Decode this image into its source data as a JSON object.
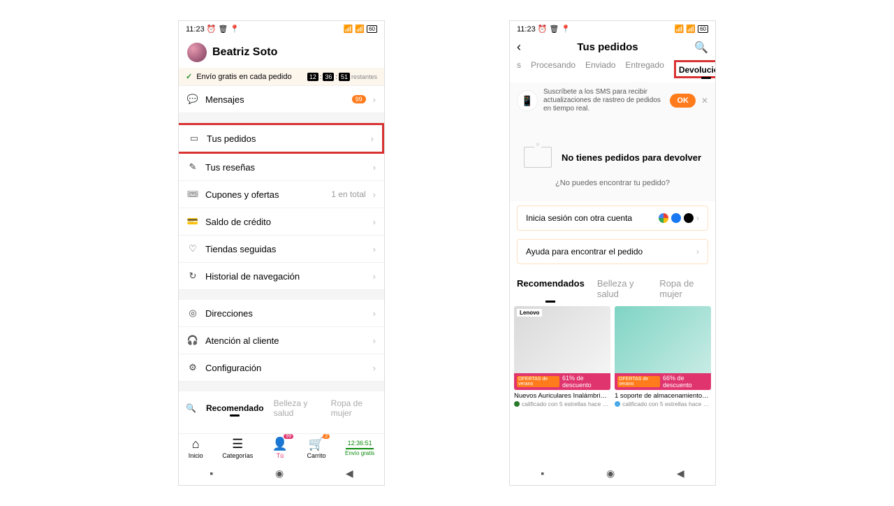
{
  "statusbar": {
    "time": "11:23"
  },
  "phone1": {
    "profile_name": "Beatriz Soto",
    "banner_text": "Envío gratis en cada pedido",
    "countdown": [
      "12",
      "36",
      "51"
    ],
    "countdown_rest": "restantes",
    "menu": {
      "mensajes": "Mensajes",
      "mensajes_badge": "99",
      "pedidos": "Tus pedidos",
      "resenas": "Tus reseñas",
      "cupones": "Cupones y ofertas",
      "cupones_trail": "1 en total",
      "saldo": "Saldo de crédito",
      "tiendas": "Tiendas seguidas",
      "historial": "Historial de navegación",
      "direcciones": "Direcciones",
      "atencion": "Atención al cliente",
      "config": "Configuración"
    },
    "rec_tabs": {
      "recom": "Recomendado",
      "belleza": "Belleza y salud",
      "ropa": "Ropa de mujer"
    },
    "bottom": {
      "inicio": "Inicio",
      "cat": "Categorías",
      "tu": "Tú",
      "tu_badge": "99",
      "carrito": "Carrito",
      "carrito_badge": "2",
      "envio_time": "12:36:51",
      "envio": "Envío gratis"
    }
  },
  "phone2": {
    "header": "Tus pedidos",
    "tabs": {
      "s": "s",
      "procesando": "Procesando",
      "enviado": "Enviado",
      "entregado": "Entregado",
      "devoluciones": "Devoluciones"
    },
    "sms": "Suscríbete a los SMS para recibir actualizaciones de rastreo de pedidos en tiempo real.",
    "ok": "OK",
    "empty_title": "No tienes pedidos para devolver",
    "empty_sub": "¿No puedes encontrar tu pedido?",
    "login_card": "Inicia sesión con otra cuenta",
    "help_card": "Ayuda para encontrar el pedido",
    "rec_tabs": {
      "recom": "Recomendados",
      "belleza": "Belleza y salud",
      "ropa": "Ropa de mujer"
    },
    "products": [
      {
        "brand": "Lenovo",
        "discount": "61% de descuento",
        "title": "Nuevos Auriculares Inalámbri…",
        "meta": "calificado con 5 estrellas hace …"
      },
      {
        "brand": "",
        "discount": "66% de descuento",
        "title": "1 soporte de almacenamiento…",
        "meta": "calificado con 5 estrellas hace …"
      }
    ],
    "offer_tag": "OFERTAS de verano"
  }
}
